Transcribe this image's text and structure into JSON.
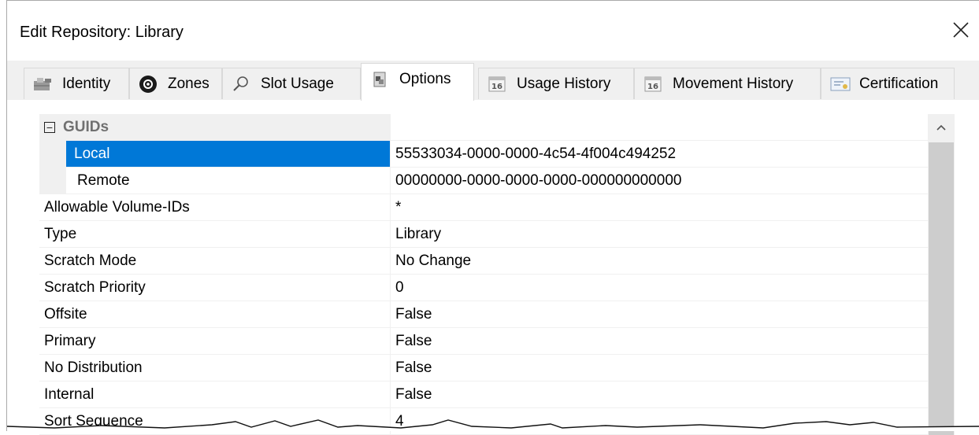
{
  "window": {
    "title": "Edit Repository: Library",
    "close_icon": "close-icon"
  },
  "tabs": [
    {
      "label": "Identity",
      "icon": "identity-icon",
      "active": false
    },
    {
      "label": "Zones",
      "icon": "zones-icon",
      "active": false
    },
    {
      "label": "Slot Usage",
      "icon": "magnifier-icon",
      "active": false
    },
    {
      "label": "Options",
      "icon": "options-icon",
      "active": true
    },
    {
      "label": "Usage History",
      "icon": "calendar-icon",
      "active": false
    },
    {
      "label": "Movement History",
      "icon": "calendar-icon",
      "active": false
    },
    {
      "label": "Certification",
      "icon": "certificate-icon",
      "active": false
    }
  ],
  "grid": {
    "category": {
      "label": "GUIDs",
      "expander": "⊟"
    },
    "guid_rows": [
      {
        "name": "Local",
        "value": "55533034-0000-0000-4c54-4f004c494252",
        "selected": true
      },
      {
        "name": "Remote",
        "value": "00000000-0000-0000-0000-000000000000",
        "selected": false
      }
    ],
    "rows": [
      {
        "name": "Allowable Volume-IDs",
        "value": "*"
      },
      {
        "name": "Type",
        "value": "Library"
      },
      {
        "name": "Scratch Mode",
        "value": "No Change"
      },
      {
        "name": "Scratch Priority",
        "value": "0"
      },
      {
        "name": "Offsite",
        "value": "False"
      },
      {
        "name": "Primary",
        "value": "False"
      },
      {
        "name": "No Distribution",
        "value": "False"
      },
      {
        "name": "Internal",
        "value": "False"
      },
      {
        "name": "Sort Sequence",
        "value": "4"
      }
    ]
  },
  "colors": {
    "selection": "#0078d7",
    "category_bg": "#f0f0f0"
  }
}
